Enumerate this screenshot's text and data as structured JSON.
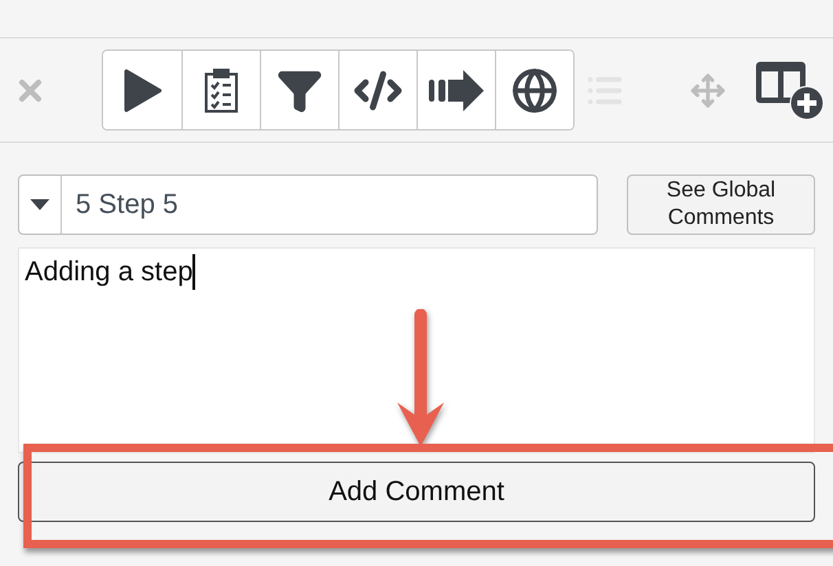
{
  "toolbar": {
    "leading": [
      {
        "kind": "close"
      }
    ],
    "tools": [
      {
        "kind": "play"
      },
      {
        "kind": "checklist"
      },
      {
        "kind": "filter"
      },
      {
        "kind": "code"
      },
      {
        "kind": "arrow"
      },
      {
        "kind": "globe"
      }
    ],
    "trailing": [
      {
        "kind": "list",
        "disabled": true
      },
      {
        "kind": "move",
        "disabled": false
      },
      {
        "kind": "add-layout",
        "disabled": false
      }
    ]
  },
  "step_select": {
    "value": "5 Step 5"
  },
  "global_comments_button": {
    "label": "See Global Comments"
  },
  "comment": {
    "value": "Adding a step",
    "focused": true
  },
  "add_button": {
    "label": "Add Comment"
  },
  "annotations": [
    {
      "kind": "arrow"
    },
    {
      "kind": "highlight"
    }
  ]
}
